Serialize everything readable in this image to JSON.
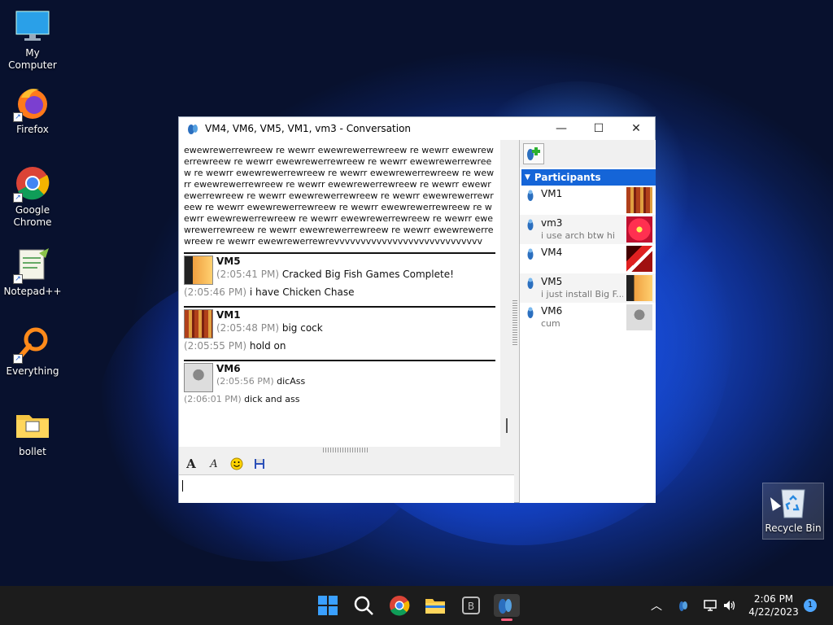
{
  "desktop": {
    "icons": [
      {
        "label": "My Computer"
      },
      {
        "label": "Firefox"
      },
      {
        "label": "Google Chrome"
      },
      {
        "label": "Notepad++"
      },
      {
        "label": "Everything"
      },
      {
        "label": "bollet"
      }
    ],
    "recycle_bin": "Recycle Bin"
  },
  "window": {
    "title": "VM4, VM6, VM5, VM1, vm3 - Conversation",
    "minimize": "—",
    "maximize": "☐",
    "close": "✕",
    "spam_text": "ewewrewerrewreew re wewrr ewewrewerrewreew re wewrr ewewrewerrewreew re wewrr ewewrewerrewreew re wewrr ewewrewerrewreew re wewrr ewewrewerrewreew re wewrr ewewrewerrewreew re wewrr ewewrewerrewreew re wewrr ewewrewerrewreew re wewrr ewewrewerrewreew re wewrr ewewrewerrewreew re wewrr ewewrewerrewreew re wewrr ewewrewerrewreew re wewrr ewewrewerrewreew re wewrr ewewrewerrewreew re wewrr ewewrewerrewreew re wewrr ewewrewerrewreew re wewrr ewewrewerrewreew re wewrr ewewrewerrewreew re wewrr ewewrewerrewrevvvvvvvvvvvvvvvvvvvvvvvvvvvv",
    "messages": [
      {
        "sender": "VM5",
        "lines": [
          {
            "ts": "(2:05:41 PM)",
            "text": " Cracked Big Fish Games Complete!"
          },
          {
            "ts": "(2:05:46 PM)",
            "text": " i have Chicken Chase"
          }
        ]
      },
      {
        "sender": "VM1",
        "lines": [
          {
            "ts": "(2:05:48 PM)",
            "text": " big cock"
          },
          {
            "ts": "(2:05:55 PM)",
            "text": " hold on"
          }
        ]
      },
      {
        "sender": "VM6",
        "lines": [
          {
            "ts": "(2:05:56 PM)",
            "text": " dicAss"
          },
          {
            "ts": "(2:06:01 PM)",
            "text": " dick and ass"
          }
        ]
      }
    ],
    "input_value": ""
  },
  "participants": {
    "header": "Participants",
    "list": [
      {
        "name": "VM1",
        "status": ""
      },
      {
        "name": "vm3",
        "status": "i use arch btw hi"
      },
      {
        "name": "VM4",
        "status": ""
      },
      {
        "name": "VM5",
        "status": "i just install Big F..."
      },
      {
        "name": "VM6",
        "status": "cum"
      }
    ]
  },
  "taskbar": {
    "time": "2:06 PM",
    "date": "4/22/2023",
    "notifications": "1"
  }
}
